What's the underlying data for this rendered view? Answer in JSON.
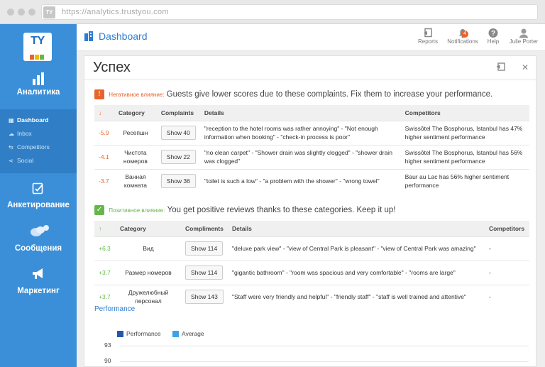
{
  "browser": {
    "url": "https://analytics.trustyou.com",
    "logo": "TY"
  },
  "sidebar": {
    "logo_text": "TY",
    "analytics_label": "Аналитика",
    "subitems": [
      {
        "label": "Dashboard",
        "icon": "dashboard-icon"
      },
      {
        "label": "Inbox",
        "icon": "inbox-icon"
      },
      {
        "label": "Competitors",
        "icon": "competitors-icon"
      },
      {
        "label": "Social",
        "icon": "share-icon"
      }
    ],
    "survey_label": "Анкетирование",
    "messages_label": "Сообщения",
    "marketing_label": "Маркетинг"
  },
  "topbar": {
    "title": "Dashboard",
    "tools": [
      {
        "label": "Reports",
        "icon": "reports-icon"
      },
      {
        "label": "Notifications",
        "icon": "bell-icon",
        "badge": "4"
      },
      {
        "label": "Help",
        "icon": "help-icon"
      },
      {
        "label": "Julie Porter",
        "icon": "user-icon"
      }
    ]
  },
  "panel": {
    "title": "Успех",
    "negative": {
      "tag": "Негативное влияние:",
      "message": "Guests give lower scores due to these complaints. Fix them to increase your performance.",
      "headers": {
        "score": "↓",
        "category": "Category",
        "complaints": "Complaints",
        "details": "Details",
        "competitors": "Competitors"
      },
      "rows": [
        {
          "score": "-5.9",
          "category": "Ресепшн",
          "button": "Show 40",
          "details": "\"reception to the hotel rooms was rather annoying\" - \"Not enough information when booking\" - \"check-in process is poor\"",
          "competitors": "Swissôtel The Bosphorus, Istanbul has 47% higher sentiment performance"
        },
        {
          "score": "-4.1",
          "category": "Чистота номеров",
          "button": "Show 22",
          "details": "\"no clean carpet\" - \"Shower drain was slightly clogged\" - \"shower drain was clogged\"",
          "competitors": "Swissôtel The Bosphorus, Istanbul has 56% higher sentiment performance"
        },
        {
          "score": "-3.7",
          "category": "Ванная комната",
          "button": "Show 36",
          "details": "\"toilet is such a low\" - \"a problem with the shower\" - \"wrong towel\"",
          "competitors": "Baur au Lac has 56% higher sentiment performance"
        }
      ]
    },
    "positive": {
      "tag": "Позитивное влияние:",
      "message": "You get positive reviews thanks to these categories. Keep it up!",
      "headers": {
        "score": "↑",
        "category": "Category",
        "compliments": "Compliments",
        "details": "Details",
        "competitors": "Competitors"
      },
      "rows": [
        {
          "score": "+6.3",
          "category": "Вид",
          "button": "Show 114",
          "details": "\"deluxe park view\" - \"view of Central Park is pleasant\" - \"view of Central Park was amazing\"",
          "competitors": "-"
        },
        {
          "score": "+3.7",
          "category": "Размер номеров",
          "button": "Show 114",
          "details": "\"gigantic bathroom\" - \"room was spacious and very comfortable\" - \"rooms are large\"",
          "competitors": "-"
        },
        {
          "score": "+3.7",
          "category": "Дружелюбный персонал",
          "button": "Show 143",
          "details": "\"Staff were very friendly and helpful\" - \"friendly staff\" - \"staff is well trained and attentive\"",
          "competitors": "-"
        }
      ]
    },
    "performance": {
      "title": "Performance",
      "legend": [
        {
          "name": "Performance",
          "color": "#2358a8"
        },
        {
          "name": "Average",
          "color": "#3fa2e6"
        }
      ],
      "yticks": [
        "93",
        "90"
      ]
    }
  },
  "colors": {
    "sidebar": "#3b8fd9",
    "accent": "#2d7dd2",
    "negative": "#e8642d",
    "positive": "#67b64c"
  }
}
